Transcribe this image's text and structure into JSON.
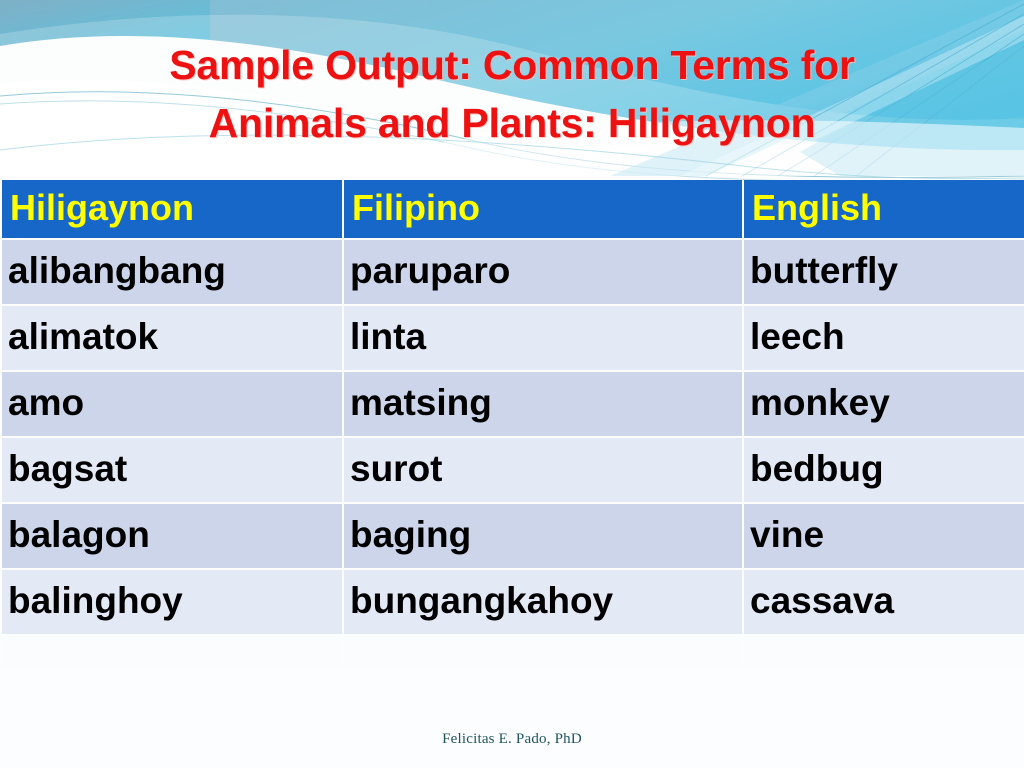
{
  "slide": {
    "title_lines": [
      "Sample Output: Common Terms for",
      "Animals and Plants:  Hiligaynon"
    ],
    "title_color": "#ee1111",
    "footer_credit": "Felicitas E. Pado, PhD",
    "footer_color": "#1f5561"
  },
  "theme": {
    "header_bg": "#1667c8",
    "header_text": "#ffff00",
    "row_band_a": "#ccd5ea",
    "row_band_b": "#e4e9f6",
    "body_text": "#000000",
    "background_top": "#7fb4cc",
    "background_accent": "#2ec8ec",
    "page_bg": "#fdfdfd"
  },
  "table": {
    "columns": [
      "Hiligaynon",
      "Filipino",
      "English"
    ],
    "rows": [
      [
        "alibangbang",
        "paruparo",
        "butterfly"
      ],
      [
        "alimatok",
        "linta",
        "leech"
      ],
      [
        "amo",
        "matsing",
        "monkey"
      ],
      [
        "bagsat",
        "surot",
        "bedbug"
      ],
      [
        "balagon",
        "baging",
        "vine"
      ],
      [
        "balinghoy",
        "bungangkahoy",
        "cassava"
      ]
    ],
    "trailing_blank_row": [
      "",
      "",
      ""
    ]
  }
}
